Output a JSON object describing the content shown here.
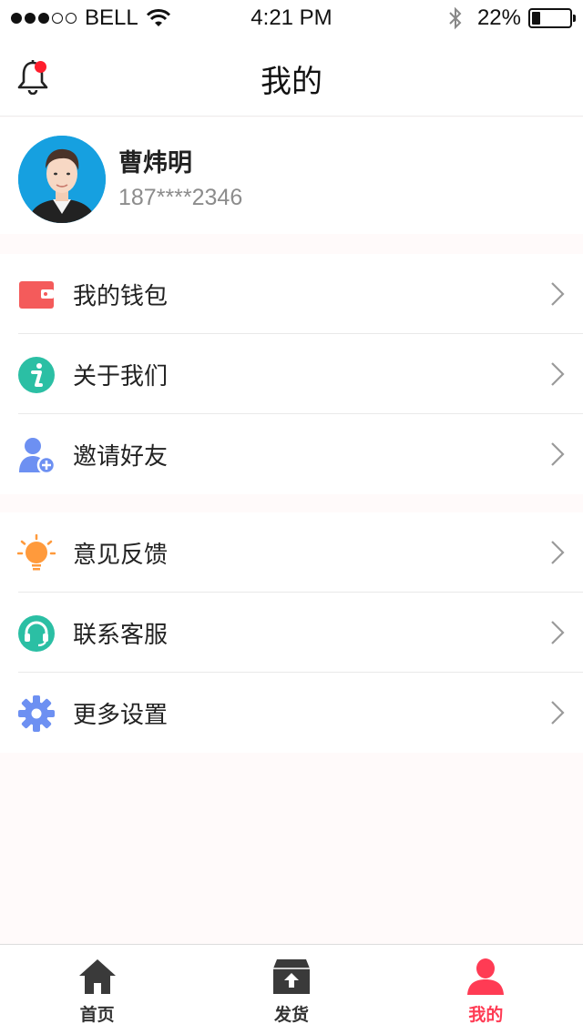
{
  "status_bar": {
    "carrier": "BELL",
    "time": "4:21 PM",
    "battery_percent": "22%",
    "battery_level": 0.22
  },
  "nav": {
    "title": "我的",
    "notification_badge": true
  },
  "profile": {
    "name": "曹炜明",
    "phone": "187****2346"
  },
  "menu_groups": [
    {
      "items": [
        {
          "label": "我的钱包",
          "icon": "wallet-icon",
          "color": "#f45b5b"
        },
        {
          "label": "关于我们",
          "icon": "info-icon",
          "color": "#2bbfa4"
        },
        {
          "label": "邀请好友",
          "icon": "invite-friend-icon",
          "color": "#6d90f2"
        }
      ]
    },
    {
      "items": [
        {
          "label": "意见反馈",
          "icon": "lightbulb-icon",
          "color": "#ff9a3c"
        },
        {
          "label": "联系客服",
          "icon": "headset-icon",
          "color": "#2bbfa4"
        },
        {
          "label": "更多设置",
          "icon": "gear-icon",
          "color": "#6d90f2"
        }
      ]
    }
  ],
  "tab_bar": {
    "tabs": [
      {
        "label": "首页",
        "icon": "home-icon",
        "active": false
      },
      {
        "label": "发货",
        "icon": "ship-box-icon",
        "active": false
      },
      {
        "label": "我的",
        "icon": "user-icon",
        "active": true
      }
    ],
    "active_color": "#ff3b54",
    "inactive_color": "#333333"
  }
}
